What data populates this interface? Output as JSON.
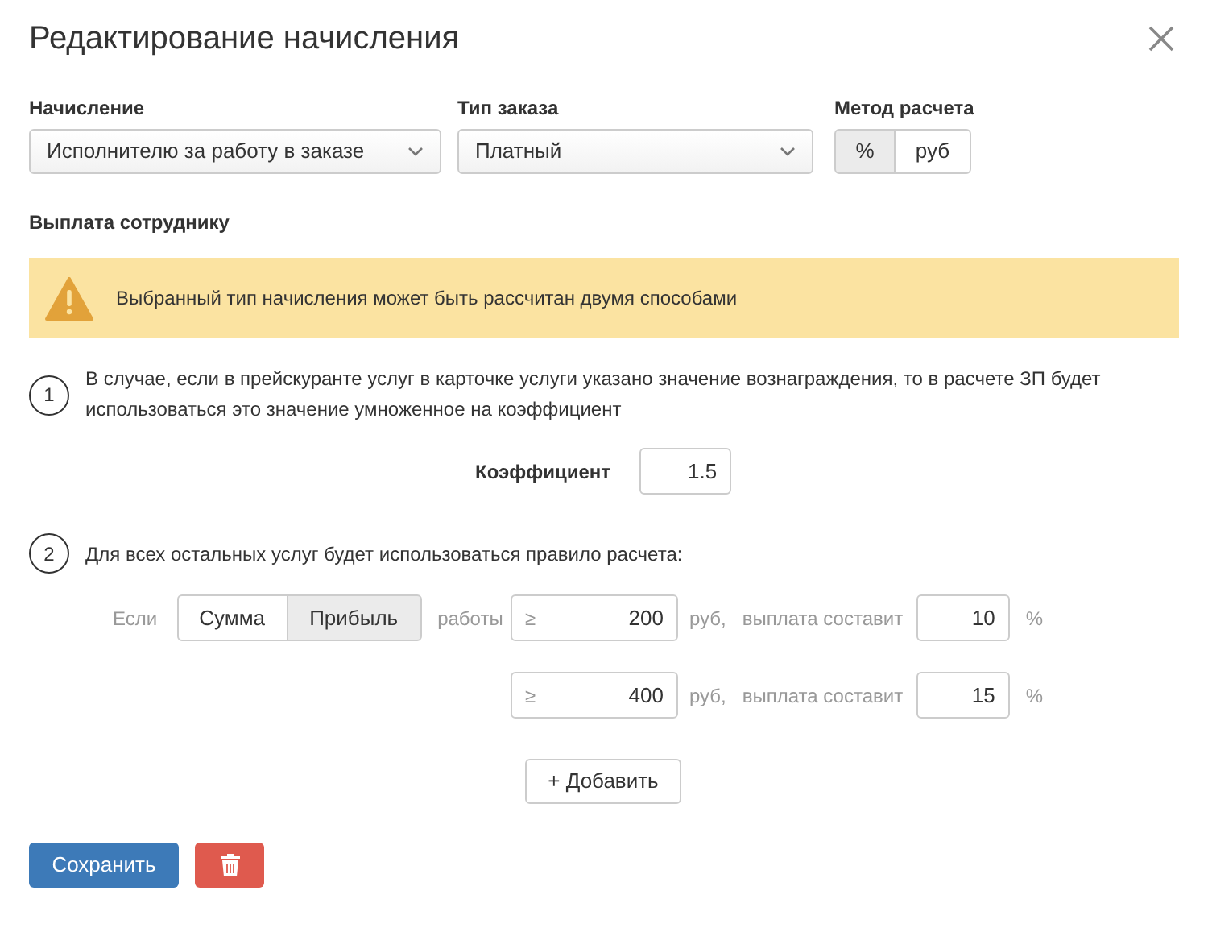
{
  "title": "Редактирование начисления",
  "fields": [
    {
      "kind": "select",
      "label": "Начисление",
      "value": "Исполнителю за работу в заказе"
    },
    {
      "kind": "select",
      "label": "Тип заказа",
      "value": "Платный"
    },
    {
      "kind": "toggle",
      "label": "Метод расчета",
      "options": [
        {
          "label": "%",
          "selected": true
        },
        {
          "label": "руб",
          "selected": false
        }
      ]
    }
  ],
  "section_title": "Выплата сотруднику",
  "alert": {
    "text": "Выбранный тип начисления может быть рассчитан двумя способами"
  },
  "step_1": {
    "number": "1",
    "text": "В случае, если в прейскуранте услуг в карточке услуги указано значение вознаграждения, то в расчете ЗП будет использоваться это значение умноженное на коэффициент",
    "coefficient_label": "Коэффициент",
    "coefficient_value": "1.5"
  },
  "step_2": {
    "number": "2",
    "text": "Для всех остальных услуг будет использоваться правило расчета:",
    "if_label": "Если",
    "base_options": [
      {
        "label": "Сумма",
        "selected": false
      },
      {
        "label": "Прибыль",
        "selected": true
      }
    ],
    "work_label": "работы",
    "thresholds": [
      {
        "sign": "≥",
        "amount": "200",
        "currency": "руб,",
        "payout_label": "выплата составит",
        "percent": "10",
        "unit": "%"
      },
      {
        "sign": "≥",
        "amount": "400",
        "currency": "руб,",
        "payout_label": "выплата составит",
        "percent": "15",
        "unit": "%"
      }
    ],
    "add_button": "+ Добавить"
  },
  "save_button": "Сохранить"
}
